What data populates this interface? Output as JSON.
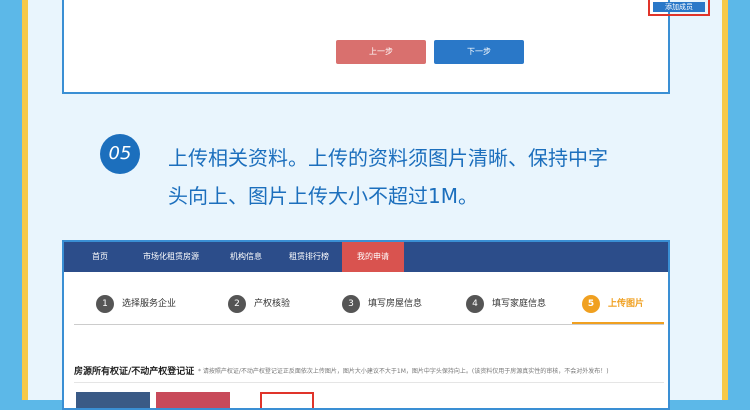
{
  "top_card": {
    "add_member_label": "添加成员",
    "prev_label": "上一步",
    "next_label": "下一步"
  },
  "step05": {
    "number": "05",
    "text_line1": "上传相关资料。上传的资料须图片清晰、保持中字",
    "text_line2": "头向上、图片上传大小不超过1M。"
  },
  "screenshot": {
    "nav": [
      "首页",
      "市场化租赁房源",
      "机构信息",
      "租赁排行榜",
      "我的申请"
    ],
    "steps": [
      {
        "num": "1",
        "label": "选择服务企业"
      },
      {
        "num": "2",
        "label": "产权核验"
      },
      {
        "num": "3",
        "label": "填写房屋信息"
      },
      {
        "num": "4",
        "label": "填写家庭信息"
      },
      {
        "num": "5",
        "label": "上传图片"
      }
    ],
    "proof_title": "房源所有权证/不动产权登记证",
    "proof_hint": "* 请按照产权证/不动产权登记证正反面依次上传图片，图片大小建议不大于1M，图片中字头保持向上。(该资料仅用于房源真实性的审核，不会对外发布！)"
  },
  "colors": {
    "accent_blue": "#1c6fbd",
    "nav_blue": "#2c4d8a",
    "active_red": "#d9534f",
    "step_orange": "#f0a020"
  }
}
